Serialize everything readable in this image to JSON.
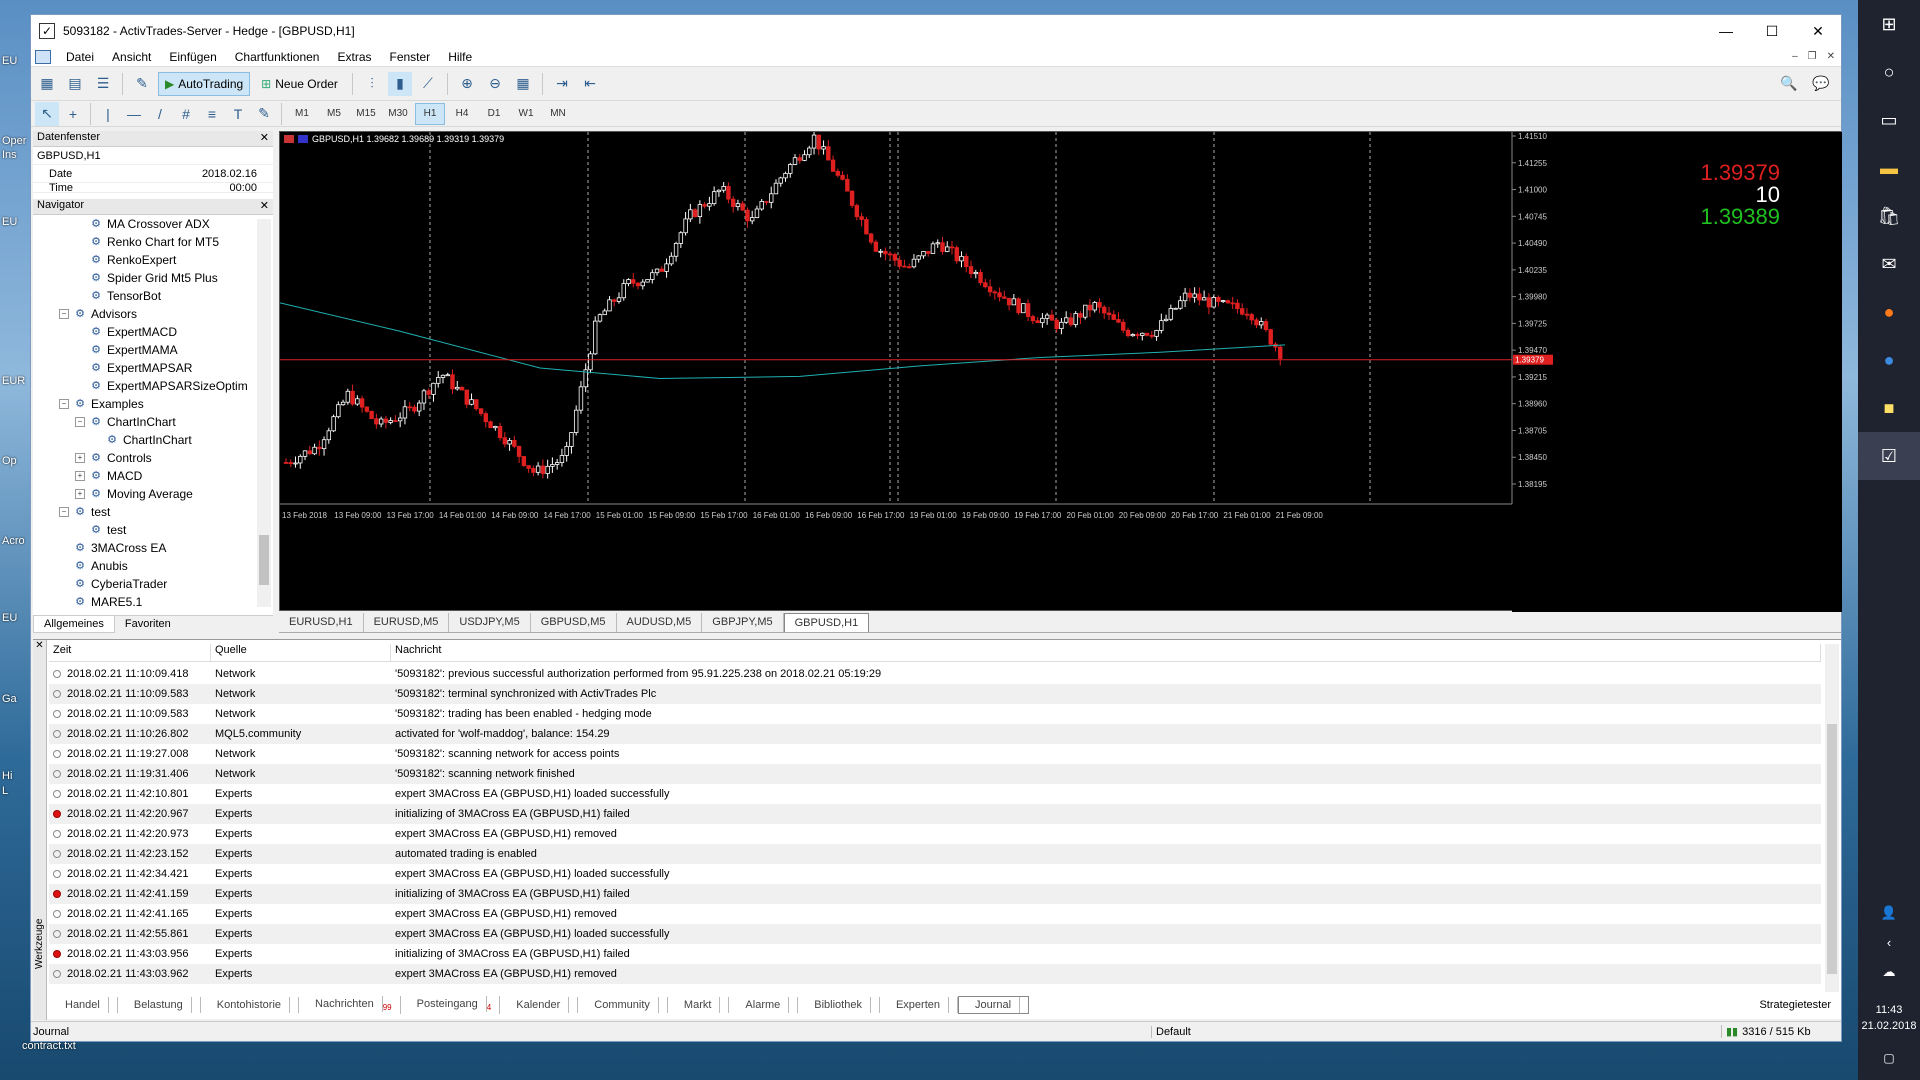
{
  "desktop": {
    "labels": [
      "EU",
      "Oper",
      "Ins",
      "EU",
      "EUR",
      "Op",
      "Acro",
      "EU",
      "Ga",
      "Hi",
      "L"
    ],
    "file_label": "contract.txt"
  },
  "window": {
    "title": "5093182 - ActivTrades-Server - Hedge - [GBPUSD,H1]",
    "menu": [
      "Datei",
      "Ansicht",
      "Einfügen",
      "Chartfunktionen",
      "Extras",
      "Fenster",
      "Hilfe"
    ]
  },
  "toolbar": {
    "autotrading": "AutoTrading",
    "neworder": "Neue Order",
    "timeframes": [
      "M1",
      "M5",
      "M15",
      "M30",
      "H1",
      "H4",
      "D1",
      "W1",
      "MN"
    ],
    "active_timeframe": "H1"
  },
  "datawindow": {
    "title": "Datenfenster",
    "symbol": "GBPUSD,H1",
    "rows": [
      {
        "k": "Date",
        "v": "2018.02.16"
      },
      {
        "k": "Time",
        "v": "00:00"
      }
    ]
  },
  "navigator": {
    "title": "Navigator",
    "items": [
      {
        "label": "MA Crossover ADX",
        "level": 3,
        "exp": ""
      },
      {
        "label": "Renko Chart for MT5",
        "level": 3,
        "exp": ""
      },
      {
        "label": "RenkoExpert",
        "level": 3,
        "exp": ""
      },
      {
        "label": "Spider Grid Mt5 Plus",
        "level": 3,
        "exp": ""
      },
      {
        "label": "TensorBot",
        "level": 3,
        "exp": ""
      },
      {
        "label": "Advisors",
        "level": 2,
        "exp": "−"
      },
      {
        "label": "ExpertMACD",
        "level": 3,
        "exp": ""
      },
      {
        "label": "ExpertMAMA",
        "level": 3,
        "exp": ""
      },
      {
        "label": "ExpertMAPSAR",
        "level": 3,
        "exp": ""
      },
      {
        "label": "ExpertMAPSARSizeOptim",
        "level": 3,
        "exp": ""
      },
      {
        "label": "Examples",
        "level": 2,
        "exp": "−"
      },
      {
        "label": "ChartInChart",
        "level": 3,
        "exp": "−"
      },
      {
        "label": "ChartInChart",
        "level": 4,
        "exp": ""
      },
      {
        "label": "Controls",
        "level": 3,
        "exp": "+"
      },
      {
        "label": "MACD",
        "level": 3,
        "exp": "+"
      },
      {
        "label": "Moving Average",
        "level": 3,
        "exp": "+"
      },
      {
        "label": "test",
        "level": 2,
        "exp": "−"
      },
      {
        "label": "test",
        "level": 3,
        "exp": ""
      },
      {
        "label": "3MACross EA",
        "level": 2,
        "exp": ""
      },
      {
        "label": "Anubis",
        "level": 2,
        "exp": ""
      },
      {
        "label": "CyberiaTrader",
        "level": 2,
        "exp": ""
      },
      {
        "label": "MARE5.1",
        "level": 2,
        "exp": ""
      }
    ],
    "tabs": [
      "Allgemeines",
      "Favoriten"
    ]
  },
  "chart": {
    "header": "GBPUSD,H1  1.39682 1.39689 1.39319 1.39379",
    "bid": "1.39379",
    "spread": "10",
    "ask": "1.39389",
    "current_price": 1.39379,
    "current_label": "1.39379",
    "colors": {
      "bull": "#ffffff",
      "bear": "#e02020",
      "ma": "#20b0b0",
      "priceline": "#e02020",
      "bid": "#e02020",
      "ask": "#20c020"
    },
    "price_ticks": [
      "1.41510",
      "1.41255",
      "1.41000",
      "1.40745",
      "1.40490",
      "1.40235",
      "1.39980",
      "1.39725",
      "1.39470",
      "1.39215",
      "1.38960",
      "1.38705",
      "1.38450",
      "1.38195"
    ],
    "date_ticks": [
      "13 Feb 2018",
      "13 Feb 09:00",
      "13 Feb 17:00",
      "14 Feb 01:00",
      "14 Feb 09:00",
      "14 Feb 17:00",
      "15 Feb 01:00",
      "15 Feb 09:00",
      "15 Feb 17:00",
      "16 Feb 01:00",
      "16 Feb 09:00",
      "16 Feb 17:00",
      "19 Feb 01:00",
      "19 Feb 09:00",
      "19 Feb 17:00",
      "20 Feb 01:00",
      "20 Feb 09:00",
      "20 Feb 17:00",
      "21 Feb 01:00",
      "21 Feb 09:00"
    ]
  },
  "chart_tabs": [
    "EURUSD,H1",
    "EURUSD,M5",
    "USDJPY,M5",
    "GBPUSD,M5",
    "AUDUSD,M5",
    "GBPJPY,M5",
    "GBPUSD,H1"
  ],
  "active_chart_tab": "GBPUSD,H1",
  "journal": {
    "columns": [
      "Zeit",
      "Quelle",
      "Nachricht"
    ],
    "side_label": "Werkzeuge",
    "rows": [
      {
        "t": "2018.02.21 11:10:09.418",
        "s": "Network",
        "m": "'5093182': previous successful authorization performed from 95.91.225.238 on 2018.02.21 05:19:29",
        "err": false
      },
      {
        "t": "2018.02.21 11:10:09.583",
        "s": "Network",
        "m": "'5093182': terminal synchronized with ActivTrades Plc",
        "err": false
      },
      {
        "t": "2018.02.21 11:10:09.583",
        "s": "Network",
        "m": "'5093182': trading has been enabled - hedging mode",
        "err": false
      },
      {
        "t": "2018.02.21 11:10:26.802",
        "s": "MQL5.community",
        "m": "activated for 'wolf-maddog', balance: 154.29",
        "err": false
      },
      {
        "t": "2018.02.21 11:19:27.008",
        "s": "Network",
        "m": "'5093182': scanning network for access points",
        "err": false
      },
      {
        "t": "2018.02.21 11:19:31.406",
        "s": "Network",
        "m": "'5093182': scanning network finished",
        "err": false
      },
      {
        "t": "2018.02.21 11:42:10.801",
        "s": "Experts",
        "m": "expert 3MACross EA (GBPUSD,H1) loaded successfully",
        "err": false
      },
      {
        "t": "2018.02.21 11:42:20.967",
        "s": "Experts",
        "m": "initializing of 3MACross EA (GBPUSD,H1) failed",
        "err": true
      },
      {
        "t": "2018.02.21 11:42:20.973",
        "s": "Experts",
        "m": "expert 3MACross EA (GBPUSD,H1) removed",
        "err": false
      },
      {
        "t": "2018.02.21 11:42:23.152",
        "s": "Experts",
        "m": "automated trading is enabled",
        "err": false
      },
      {
        "t": "2018.02.21 11:42:34.421",
        "s": "Experts",
        "m": "expert 3MACross EA (GBPUSD,H1) loaded successfully",
        "err": false
      },
      {
        "t": "2018.02.21 11:42:41.159",
        "s": "Experts",
        "m": "initializing of 3MACross EA (GBPUSD,H1) failed",
        "err": true
      },
      {
        "t": "2018.02.21 11:42:41.165",
        "s": "Experts",
        "m": "expert 3MACross EA (GBPUSD,H1) removed",
        "err": false
      },
      {
        "t": "2018.02.21 11:42:55.861",
        "s": "Experts",
        "m": "expert 3MACross EA (GBPUSD,H1) loaded successfully",
        "err": false
      },
      {
        "t": "2018.02.21 11:43:03.956",
        "s": "Experts",
        "m": "initializing of 3MACross EA (GBPUSD,H1) failed",
        "err": true
      },
      {
        "t": "2018.02.21 11:43:03.962",
        "s": "Experts",
        "m": "expert 3MACross EA (GBPUSD,H1) removed",
        "err": false
      }
    ]
  },
  "bottom_tabs": [
    {
      "label": "Handel",
      "badge": ""
    },
    {
      "label": "Belastung",
      "badge": ""
    },
    {
      "label": "Kontohistorie",
      "badge": ""
    },
    {
      "label": "Nachrichten",
      "badge": "99"
    },
    {
      "label": "Posteingang",
      "badge": "4"
    },
    {
      "label": "Kalender",
      "badge": ""
    },
    {
      "label": "Community",
      "badge": ""
    },
    {
      "label": "Markt",
      "badge": ""
    },
    {
      "label": "Alarme",
      "badge": ""
    },
    {
      "label": "Bibliothek",
      "badge": ""
    },
    {
      "label": "Experten",
      "badge": ""
    },
    {
      "label": "Journal",
      "badge": ""
    }
  ],
  "active_bottom_tab": "Journal",
  "strategy_tester": "Strategietester",
  "status": {
    "left": "Journal",
    "profile": "Default",
    "traffic": "3316 / 515 Kb"
  },
  "clock": {
    "time": "11:43",
    "date": "21.02.2018"
  }
}
